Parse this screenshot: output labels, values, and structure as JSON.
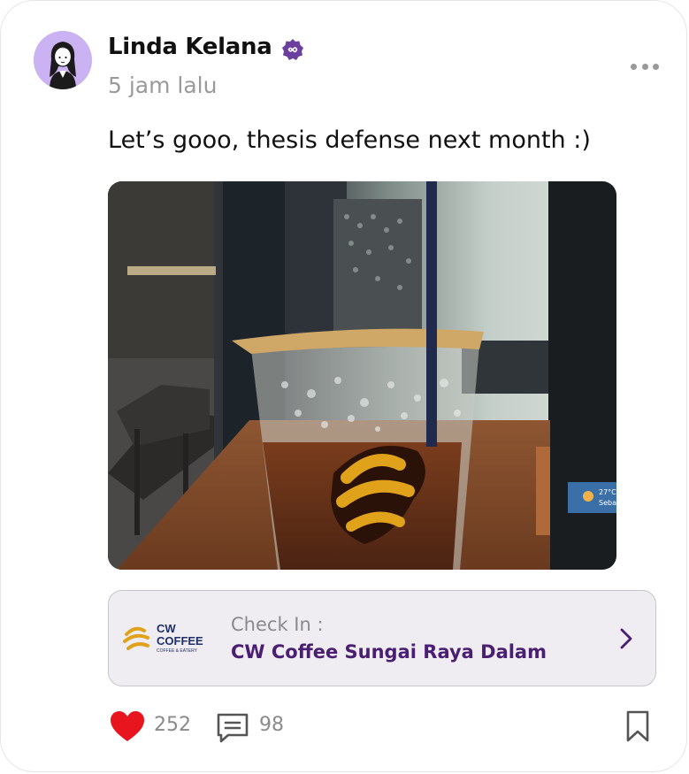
{
  "post": {
    "author_name": "Linda Kelana",
    "timestamp": "5 jam lalu",
    "text": "Let’s gooo, thesis defense next month :)",
    "photo_alt": "Iced coffee in a CW Coffee cup on a cafe table",
    "laptop_temp": "27°C",
    "laptop_weather_text": "Seba",
    "cup_logo": "cw-coffee-cup-logo"
  },
  "checkin": {
    "label": "Check In :",
    "place": "CW Coffee Sungai Raya Dalam",
    "brand_logo": {
      "line1": "CW",
      "line2": "COFFEE",
      "line3": "COFFEE & EATERY"
    }
  },
  "actions": {
    "likes": "252",
    "comments": "98"
  },
  "icons": {
    "verified": "verified-badge-icon",
    "more": "more-horizontal-icon",
    "like": "heart-icon",
    "comment": "comment-icon",
    "bookmark": "bookmark-icon",
    "arrow": "chevron-right-icon"
  },
  "colors": {
    "accent": "#4a1f73",
    "verified": "#6b3fa0",
    "like": "#e8141e",
    "avatar_bg": "#cbb2f2",
    "muted": "#8a8a8a",
    "logo_gold": "#e0a21b",
    "logo_navy": "#1f2f6b"
  }
}
